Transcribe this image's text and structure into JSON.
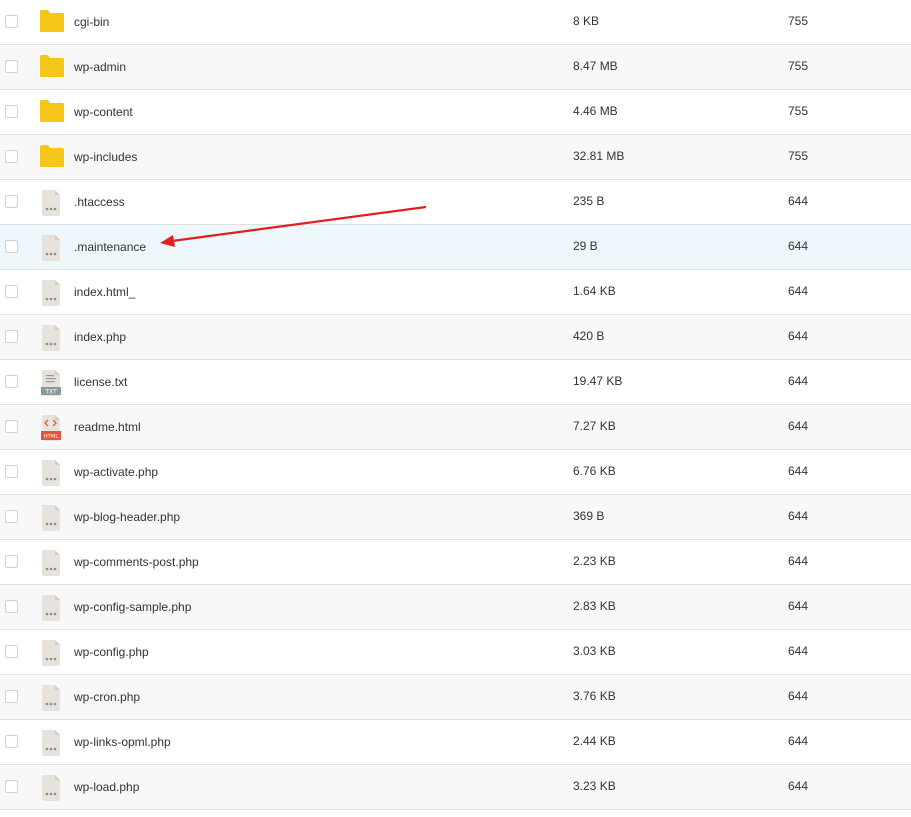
{
  "files": [
    {
      "name": "cgi-bin",
      "size": "8 KB",
      "perm": "755",
      "icon": "folder-icon"
    },
    {
      "name": "wp-admin",
      "size": "8.47 MB",
      "perm": "755",
      "icon": "folder-icon"
    },
    {
      "name": "wp-content",
      "size": "4.46 MB",
      "perm": "755",
      "icon": "folder-icon"
    },
    {
      "name": "wp-includes",
      "size": "32.81 MB",
      "perm": "755",
      "icon": "folder-icon"
    },
    {
      "name": ".htaccess",
      "size": "235 B",
      "perm": "644",
      "icon": "file-icon"
    },
    {
      "name": ".maintenance",
      "size": "29 B",
      "perm": "644",
      "icon": "file-icon"
    },
    {
      "name": "index.html_",
      "size": "1.64 KB",
      "perm": "644",
      "icon": "file-icon"
    },
    {
      "name": "index.php",
      "size": "420 B",
      "perm": "644",
      "icon": "file-icon"
    },
    {
      "name": "license.txt",
      "size": "19.47 KB",
      "perm": "644",
      "icon": "txt-file-icon",
      "badge": "TXT"
    },
    {
      "name": "readme.html",
      "size": "7.27 KB",
      "perm": "644",
      "icon": "html-file-icon",
      "badge": "HTML"
    },
    {
      "name": "wp-activate.php",
      "size": "6.76 KB",
      "perm": "644",
      "icon": "file-icon"
    },
    {
      "name": "wp-blog-header.php",
      "size": "369 B",
      "perm": "644",
      "icon": "file-icon"
    },
    {
      "name": "wp-comments-post.php",
      "size": "2.23 KB",
      "perm": "644",
      "icon": "file-icon"
    },
    {
      "name": "wp-config-sample.php",
      "size": "2.83 KB",
      "perm": "644",
      "icon": "file-icon"
    },
    {
      "name": "wp-config.php",
      "size": "3.03 KB",
      "perm": "644",
      "icon": "file-icon"
    },
    {
      "name": "wp-cron.php",
      "size": "3.76 KB",
      "perm": "644",
      "icon": "file-icon"
    },
    {
      "name": "wp-links-opml.php",
      "size": "2.44 KB",
      "perm": "644",
      "icon": "file-icon"
    },
    {
      "name": "wp-load.php",
      "size": "3.23 KB",
      "perm": "644",
      "icon": "file-icon"
    }
  ],
  "highlighted_row": 5,
  "colors": {
    "folder": "#f5c518",
    "row_alt": "#f8f8f8",
    "row_highlight": "#eef7fc",
    "arrow": "#e41e1e",
    "html_badge": "#e8543a",
    "txt_badge": "#8a9a9a"
  }
}
